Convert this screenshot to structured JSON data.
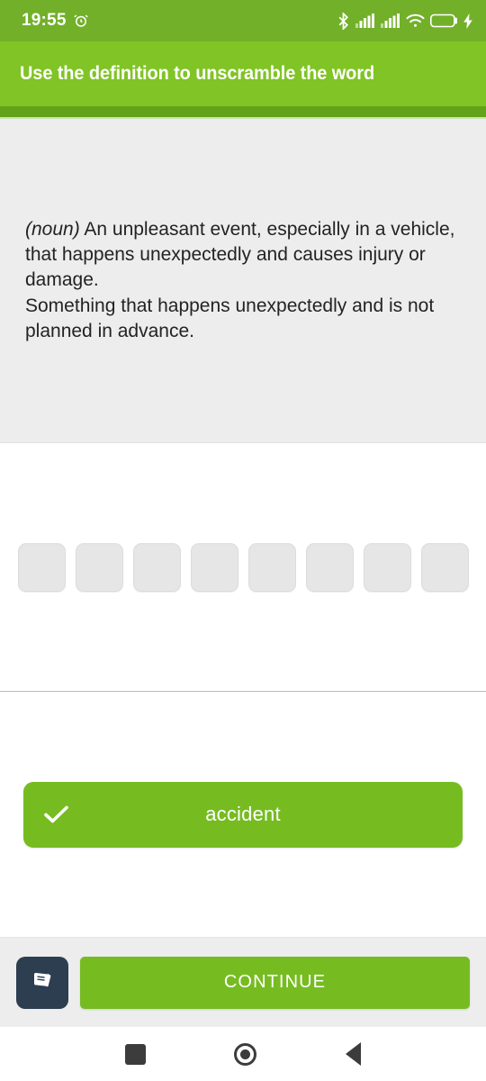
{
  "statusbar": {
    "time": "19:55",
    "alarm_icon": "alarm-clock-icon",
    "bluetooth_icon": "bluetooth-icon",
    "signal1_icon": "signal-bars-icon",
    "signal2_icon": "signal-bars-icon",
    "wifi_icon": "wifi-icon",
    "battery_level": "91",
    "charging_icon": "charging-bolt-icon"
  },
  "header": {
    "title": "Use the definition to unscramble the word",
    "progress_percent": 100,
    "background_color": "#80c425",
    "progress_color": "#62a319"
  },
  "definition": {
    "part_of_speech": "(noun)",
    "line1": " An unpleasant event, especially in a vehicle, that happens unexpectedly and causes injury or damage.",
    "line2": "Something that happens unexpectedly and is not planned in advance."
  },
  "tiles": {
    "count": 8,
    "values": [
      "",
      "",
      "",
      "",
      "",
      "",
      "",
      ""
    ]
  },
  "answer": {
    "word": "accident",
    "check_icon": "check-icon",
    "color": "#76bc21"
  },
  "bottom": {
    "dictionary_icon": "book-icon",
    "continue_label": "CONTINUE",
    "continue_color": "#76bc21",
    "icon_button_color": "#2d3e50"
  },
  "navbar": {
    "recents_icon": "square-recents-icon",
    "home_icon": "circle-home-icon",
    "back_icon": "triangle-back-icon"
  }
}
